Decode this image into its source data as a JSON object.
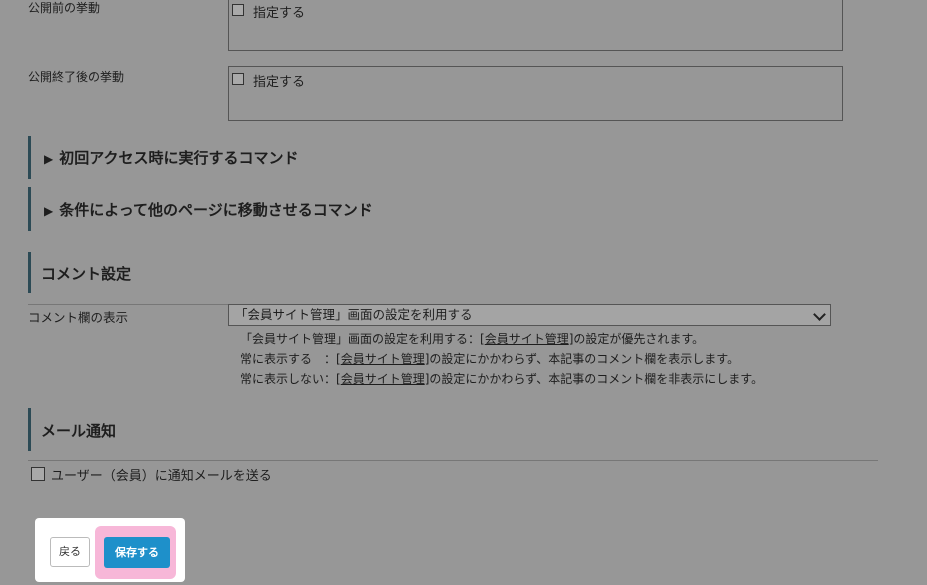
{
  "before_publish": {
    "label": "公開前の挙動",
    "checkbox_label": "指定する"
  },
  "after_publish": {
    "label": "公開終了後の挙動",
    "checkbox_label": "指定する"
  },
  "collapsible_sections": [
    {
      "title": "初回アクセス時に実行するコマンド",
      "icon": "triangle-right"
    },
    {
      "title": "条件によって他のページに移動させるコマンド",
      "icon": "triangle-right"
    }
  ],
  "comment_settings": {
    "section_title": "コメント設定",
    "field_label": "コメント欄の表示",
    "select_value": "「会員サイト管理」画面の設定を利用する",
    "help_lines": [
      {
        "prefix": "「会員サイト管理」画面の設定を利用する：[",
        "link": "会員サイト管理",
        "suffix": "]の設定が優先されます。"
      },
      {
        "prefix": "常に表示する　：[",
        "link": "会員サイト管理",
        "suffix": "]の設定にかかわらず、本記事のコメント欄を表示します。"
      },
      {
        "prefix": "常に表示しない：[",
        "link": "会員サイト管理",
        "suffix": "]の設定にかかわらず、本記事のコメント欄を非表示にします。"
      }
    ]
  },
  "mail_notification": {
    "section_title": "メール通知",
    "checkbox_label": "ユーザー（会員）に通知メールを送る"
  },
  "actions": {
    "back_label": "戻る",
    "save_label": "保存する"
  },
  "colors": {
    "save_button": "#1e90ca",
    "highlight": "#f7b7d8",
    "section_bar": "#2c4a55"
  }
}
